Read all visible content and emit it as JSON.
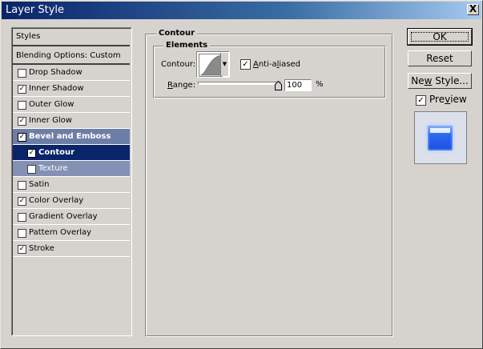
{
  "window": {
    "title": "Layer Style",
    "close_label": "X"
  },
  "styles_list": {
    "header": "Styles",
    "blending": "Blending Options: Custom",
    "items": [
      {
        "label": "Drop Shadow",
        "checked": false,
        "state": "normal"
      },
      {
        "label": "Inner Shadow",
        "checked": true,
        "state": "normal"
      },
      {
        "label": "Outer Glow",
        "checked": false,
        "state": "normal"
      },
      {
        "label": "Inner Glow",
        "checked": true,
        "state": "normal"
      },
      {
        "label": "Bevel and Emboss",
        "checked": true,
        "state": "highlight"
      },
      {
        "label": "Contour",
        "checked": true,
        "state": "selected"
      },
      {
        "label": "Texture",
        "checked": false,
        "state": "sub"
      },
      {
        "label": "Satin",
        "checked": false,
        "state": "normal"
      },
      {
        "label": "Color Overlay",
        "checked": true,
        "state": "normal"
      },
      {
        "label": "Gradient Overlay",
        "checked": false,
        "state": "normal"
      },
      {
        "label": "Pattern Overlay",
        "checked": false,
        "state": "normal"
      },
      {
        "label": "Stroke",
        "checked": true,
        "state": "normal"
      }
    ]
  },
  "contour_panel": {
    "title": "Contour",
    "elements_title": "Elements",
    "contour_label": "Contour:",
    "anti_aliased_label": "Anti-aliased",
    "anti_aliased_checked": true,
    "range_label": "Range:",
    "range_value": "100",
    "range_unit": "%"
  },
  "buttons": {
    "ok": "OK",
    "reset": "Reset",
    "new_style": "New Style...",
    "preview_label": "Preview",
    "preview_checked": true
  },
  "colors": {
    "dialog_bg": "#d6d3ce",
    "title_bar": "#0a246a",
    "row_selected": "#0a246a",
    "row_highlight": "#6d7ea6",
    "preview_swatch": "#2b6af0"
  }
}
